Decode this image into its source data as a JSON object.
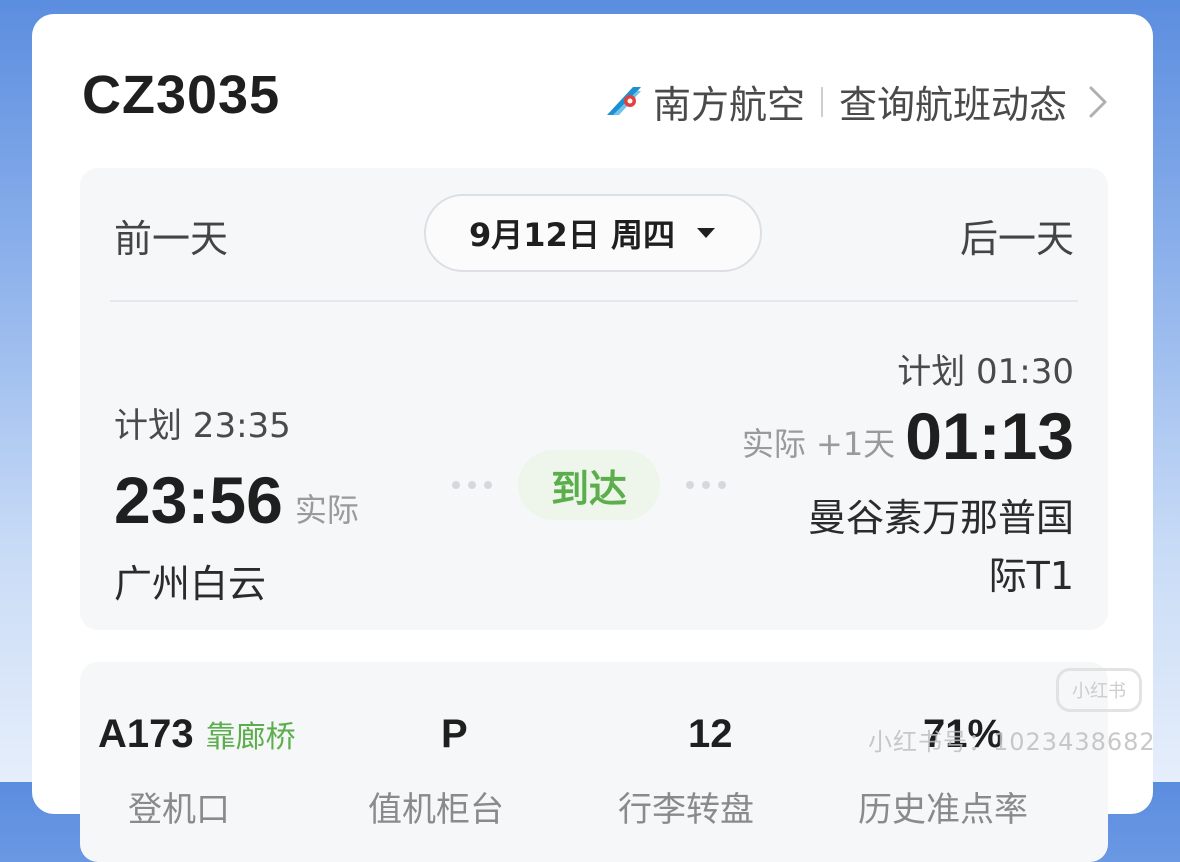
{
  "flight": {
    "number": "CZ3035",
    "airline": "南方航空",
    "query_link": "查询航班动态"
  },
  "date_nav": {
    "prev": "前一天",
    "current": "9月12日 周四",
    "next": "后一天"
  },
  "departure": {
    "scheduled": "计划 23:35",
    "actual_time": "23:56",
    "actual_label": "实际",
    "airport": "广州白云"
  },
  "status": {
    "label": "到达",
    "color": "#5cae4c"
  },
  "arrival": {
    "scheduled": "计划 01:30",
    "actual_label": "实际 +1天",
    "actual_time": "01:13",
    "airport": "曼谷素万那普国际T1"
  },
  "details": {
    "gate": "A173",
    "gate_type": "靠廊桥",
    "stand": "P",
    "belt": "12",
    "on_time_rate": "71%",
    "labels": [
      "登机口",
      "值机柜台",
      "行李转盘",
      "历史准点率"
    ]
  },
  "watermark": {
    "text": "小红书号：1023438682",
    "logo": "小红书"
  },
  "colors": {
    "accent_green": "#5cae4c",
    "text_dark": "#1f1f1f",
    "panel_bg": "#f6f7f9"
  }
}
